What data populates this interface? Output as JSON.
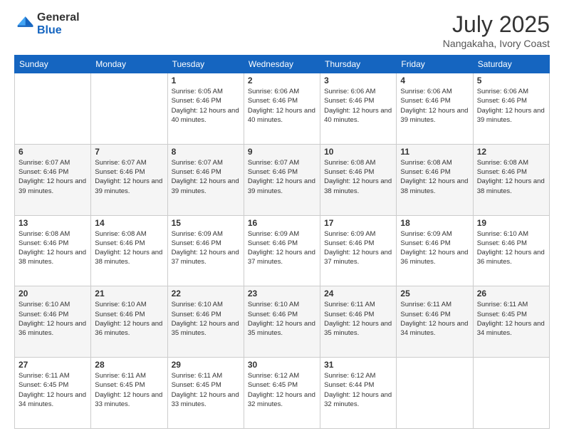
{
  "header": {
    "logo_line1": "General",
    "logo_line2": "Blue",
    "month_year": "July 2025",
    "location": "Nangakaha, Ivory Coast"
  },
  "weekdays": [
    "Sunday",
    "Monday",
    "Tuesday",
    "Wednesday",
    "Thursday",
    "Friday",
    "Saturday"
  ],
  "weeks": [
    [
      {
        "day": "",
        "info": ""
      },
      {
        "day": "",
        "info": ""
      },
      {
        "day": "1",
        "info": "Sunrise: 6:05 AM\nSunset: 6:46 PM\nDaylight: 12 hours and 40 minutes."
      },
      {
        "day": "2",
        "info": "Sunrise: 6:06 AM\nSunset: 6:46 PM\nDaylight: 12 hours and 40 minutes."
      },
      {
        "day": "3",
        "info": "Sunrise: 6:06 AM\nSunset: 6:46 PM\nDaylight: 12 hours and 40 minutes."
      },
      {
        "day": "4",
        "info": "Sunrise: 6:06 AM\nSunset: 6:46 PM\nDaylight: 12 hours and 39 minutes."
      },
      {
        "day": "5",
        "info": "Sunrise: 6:06 AM\nSunset: 6:46 PM\nDaylight: 12 hours and 39 minutes."
      }
    ],
    [
      {
        "day": "6",
        "info": "Sunrise: 6:07 AM\nSunset: 6:46 PM\nDaylight: 12 hours and 39 minutes."
      },
      {
        "day": "7",
        "info": "Sunrise: 6:07 AM\nSunset: 6:46 PM\nDaylight: 12 hours and 39 minutes."
      },
      {
        "day": "8",
        "info": "Sunrise: 6:07 AM\nSunset: 6:46 PM\nDaylight: 12 hours and 39 minutes."
      },
      {
        "day": "9",
        "info": "Sunrise: 6:07 AM\nSunset: 6:46 PM\nDaylight: 12 hours and 39 minutes."
      },
      {
        "day": "10",
        "info": "Sunrise: 6:08 AM\nSunset: 6:46 PM\nDaylight: 12 hours and 38 minutes."
      },
      {
        "day": "11",
        "info": "Sunrise: 6:08 AM\nSunset: 6:46 PM\nDaylight: 12 hours and 38 minutes."
      },
      {
        "day": "12",
        "info": "Sunrise: 6:08 AM\nSunset: 6:46 PM\nDaylight: 12 hours and 38 minutes."
      }
    ],
    [
      {
        "day": "13",
        "info": "Sunrise: 6:08 AM\nSunset: 6:46 PM\nDaylight: 12 hours and 38 minutes."
      },
      {
        "day": "14",
        "info": "Sunrise: 6:08 AM\nSunset: 6:46 PM\nDaylight: 12 hours and 38 minutes."
      },
      {
        "day": "15",
        "info": "Sunrise: 6:09 AM\nSunset: 6:46 PM\nDaylight: 12 hours and 37 minutes."
      },
      {
        "day": "16",
        "info": "Sunrise: 6:09 AM\nSunset: 6:46 PM\nDaylight: 12 hours and 37 minutes."
      },
      {
        "day": "17",
        "info": "Sunrise: 6:09 AM\nSunset: 6:46 PM\nDaylight: 12 hours and 37 minutes."
      },
      {
        "day": "18",
        "info": "Sunrise: 6:09 AM\nSunset: 6:46 PM\nDaylight: 12 hours and 36 minutes."
      },
      {
        "day": "19",
        "info": "Sunrise: 6:10 AM\nSunset: 6:46 PM\nDaylight: 12 hours and 36 minutes."
      }
    ],
    [
      {
        "day": "20",
        "info": "Sunrise: 6:10 AM\nSunset: 6:46 PM\nDaylight: 12 hours and 36 minutes."
      },
      {
        "day": "21",
        "info": "Sunrise: 6:10 AM\nSunset: 6:46 PM\nDaylight: 12 hours and 36 minutes."
      },
      {
        "day": "22",
        "info": "Sunrise: 6:10 AM\nSunset: 6:46 PM\nDaylight: 12 hours and 35 minutes."
      },
      {
        "day": "23",
        "info": "Sunrise: 6:10 AM\nSunset: 6:46 PM\nDaylight: 12 hours and 35 minutes."
      },
      {
        "day": "24",
        "info": "Sunrise: 6:11 AM\nSunset: 6:46 PM\nDaylight: 12 hours and 35 minutes."
      },
      {
        "day": "25",
        "info": "Sunrise: 6:11 AM\nSunset: 6:46 PM\nDaylight: 12 hours and 34 minutes."
      },
      {
        "day": "26",
        "info": "Sunrise: 6:11 AM\nSunset: 6:45 PM\nDaylight: 12 hours and 34 minutes."
      }
    ],
    [
      {
        "day": "27",
        "info": "Sunrise: 6:11 AM\nSunset: 6:45 PM\nDaylight: 12 hours and 34 minutes."
      },
      {
        "day": "28",
        "info": "Sunrise: 6:11 AM\nSunset: 6:45 PM\nDaylight: 12 hours and 33 minutes."
      },
      {
        "day": "29",
        "info": "Sunrise: 6:11 AM\nSunset: 6:45 PM\nDaylight: 12 hours and 33 minutes."
      },
      {
        "day": "30",
        "info": "Sunrise: 6:12 AM\nSunset: 6:45 PM\nDaylight: 12 hours and 32 minutes."
      },
      {
        "day": "31",
        "info": "Sunrise: 6:12 AM\nSunset: 6:44 PM\nDaylight: 12 hours and 32 minutes."
      },
      {
        "day": "",
        "info": ""
      },
      {
        "day": "",
        "info": ""
      }
    ]
  ]
}
